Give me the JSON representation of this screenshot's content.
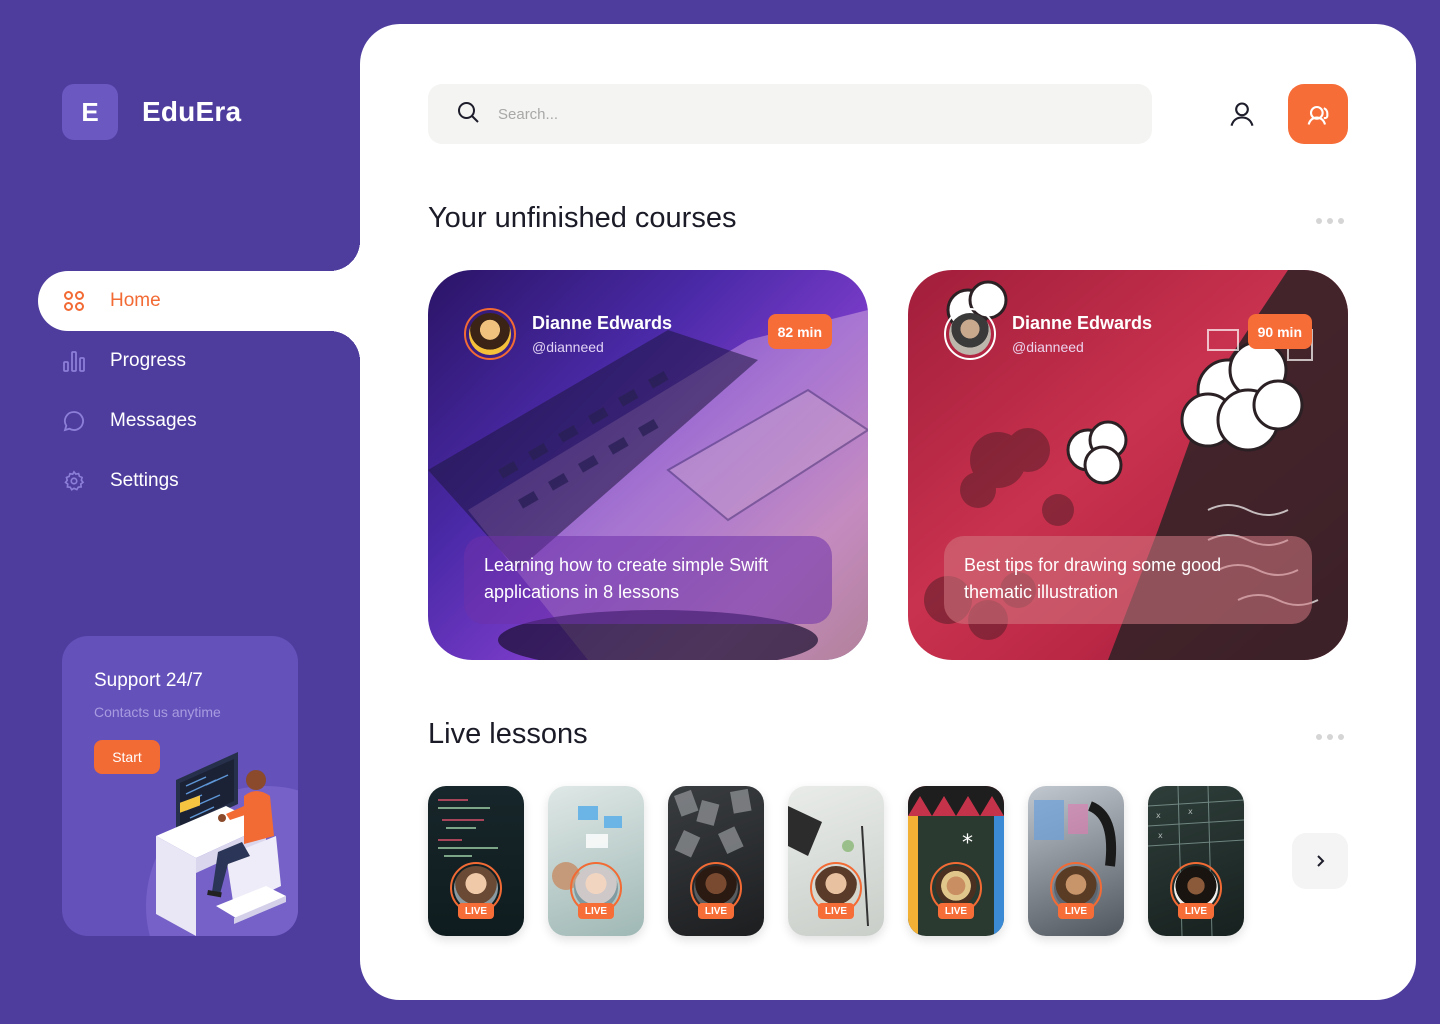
{
  "app": {
    "logo_letter": "E",
    "name": "EduEra"
  },
  "nav": [
    {
      "label": "Home",
      "icon": "grid-icon",
      "active": true
    },
    {
      "label": "Progress",
      "icon": "bar-chart-icon",
      "active": false
    },
    {
      "label": "Messages",
      "icon": "chat-bubble-icon",
      "active": false
    },
    {
      "label": "Settings",
      "icon": "gear-icon",
      "active": false
    }
  ],
  "support": {
    "title": "Support 24/7",
    "subtitle": "Contacts us anytime",
    "button": "Start"
  },
  "search": {
    "placeholder": "Search..."
  },
  "sections": {
    "courses_title": "Your unfinished courses",
    "live_title": "Live lessons"
  },
  "courses": [
    {
      "author": "Dianne Edwards",
      "handle": "@dianneed",
      "duration": "82 min",
      "title": "Learning how to create simple Swift applications in 8 lessons"
    },
    {
      "author": "Dianne Edwards",
      "handle": "@dianneed",
      "duration": "90 min",
      "title": "Best tips for drawing some good thematic illustration"
    }
  ],
  "live": {
    "badge": "LIVE",
    "count": 7
  },
  "colors": {
    "brand": "#4f3d9e",
    "accent": "#f76d38",
    "surface": "#ffffff"
  }
}
